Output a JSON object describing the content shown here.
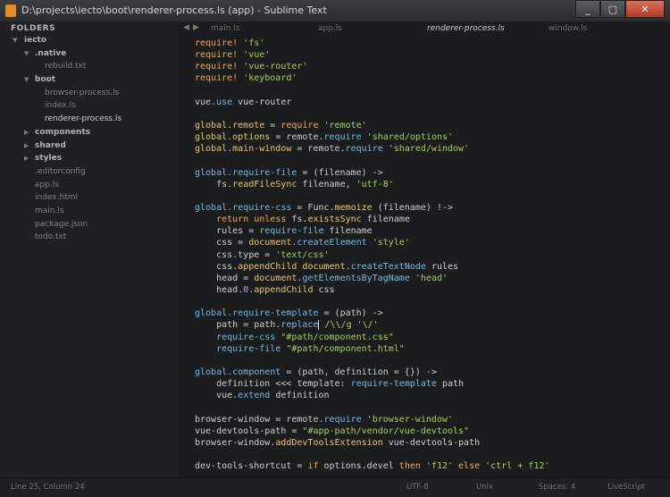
{
  "window": {
    "title": "D:\\projects\\iecto\\boot\\renderer-process.ls (app) - Sublime Text",
    "buttons": [
      "_",
      "▢",
      "✕"
    ]
  },
  "sidebar": {
    "header": "FOLDERS",
    "items": [
      {
        "label": "iecto",
        "type": "folder",
        "depth": 0,
        "arrow": "open"
      },
      {
        "label": ".native",
        "type": "folder",
        "depth": 1,
        "arrow": "open"
      },
      {
        "label": "rebuild.txt",
        "type": "file",
        "depth": 2
      },
      {
        "label": "boot",
        "type": "folder",
        "depth": 1,
        "arrow": "open"
      },
      {
        "label": "browser-process.ls",
        "type": "file",
        "depth": 2
      },
      {
        "label": "index.ls",
        "type": "file",
        "depth": 2
      },
      {
        "label": "renderer-process.ls",
        "type": "file",
        "depth": 2,
        "active": true
      },
      {
        "label": "components",
        "type": "folder",
        "depth": 1,
        "arrow": "closed"
      },
      {
        "label": "shared",
        "type": "folder",
        "depth": 1,
        "arrow": "closed"
      },
      {
        "label": "styles",
        "type": "folder",
        "depth": 1,
        "arrow": "closed"
      },
      {
        "label": ".editorconfig",
        "type": "file",
        "depth": 1
      },
      {
        "label": "app.ls",
        "type": "file",
        "depth": 1
      },
      {
        "label": "index.html",
        "type": "file",
        "depth": 1
      },
      {
        "label": "main.ls",
        "type": "file",
        "depth": 1
      },
      {
        "label": "package.json",
        "type": "file",
        "depth": 1
      },
      {
        "label": "todo.txt",
        "type": "file",
        "depth": 1
      }
    ]
  },
  "tabs": [
    {
      "label": "main.ls",
      "active": false
    },
    {
      "label": "app.ls",
      "active": false
    },
    {
      "label": "renderer-process.ls",
      "active": true
    },
    {
      "label": "window.ls",
      "active": false
    }
  ],
  "code_lines": [
    [
      [
        "require! ",
        "k"
      ],
      [
        "'fs'",
        "s"
      ]
    ],
    [
      [
        "require! ",
        "k"
      ],
      [
        "'vue'",
        "s"
      ]
    ],
    [
      [
        "require! ",
        "k"
      ],
      [
        "'vue-router'",
        "s"
      ]
    ],
    [
      [
        "require! ",
        "k"
      ],
      [
        "'keyboard'",
        "s"
      ]
    ],
    [],
    [
      [
        "vue",
        "p"
      ],
      [
        ".use",
        "f"
      ],
      [
        " vue-router",
        "p"
      ]
    ],
    [],
    [
      [
        "global.remote",
        "v"
      ],
      [
        " = ",
        "p"
      ],
      [
        "require",
        "k"
      ],
      [
        " 'remote'",
        "s"
      ]
    ],
    [
      [
        "global.options",
        "v"
      ],
      [
        " = remote.",
        "p"
      ],
      [
        "require",
        "f"
      ],
      [
        " 'shared/options'",
        "s"
      ]
    ],
    [
      [
        "global.main-window",
        "v"
      ],
      [
        " = remote.",
        "p"
      ],
      [
        "require",
        "f"
      ],
      [
        " 'shared/window'",
        "s"
      ]
    ],
    [],
    [
      [
        "global.require-file",
        "f"
      ],
      [
        " = (filename) ->",
        "p"
      ]
    ],
    [
      [
        "    fs.",
        "p"
      ],
      [
        "readFileSync",
        "v"
      ],
      [
        " filename, ",
        "p"
      ],
      [
        "'utf-8'",
        "s"
      ]
    ],
    [],
    [
      [
        "global.require-css",
        "f"
      ],
      [
        " = Func.",
        "p"
      ],
      [
        "memoize",
        "v"
      ],
      [
        " (filename) !->",
        "p"
      ]
    ],
    [
      [
        "    ",
        "p"
      ],
      [
        "return unless",
        "k"
      ],
      [
        " fs.",
        "p"
      ],
      [
        "existsSync",
        "v"
      ],
      [
        " filename",
        "p"
      ]
    ],
    [
      [
        "    rules = ",
        "p"
      ],
      [
        "require-file",
        "f"
      ],
      [
        " filename",
        "p"
      ]
    ],
    [
      [
        "    css = ",
        "p"
      ],
      [
        "document",
        "v"
      ],
      [
        ".",
        "p"
      ],
      [
        "createElement",
        "f"
      ],
      [
        " 'style'",
        "s"
      ]
    ],
    [
      [
        "    css.type = ",
        "p"
      ],
      [
        "'text/css'",
        "s"
      ]
    ],
    [
      [
        "    css.",
        "p"
      ],
      [
        "appendChild",
        "v"
      ],
      [
        " document",
        "v"
      ],
      [
        ".",
        "p"
      ],
      [
        "createTextNode",
        "f"
      ],
      [
        " rules",
        "p"
      ]
    ],
    [
      [
        "    head = ",
        "p"
      ],
      [
        "document",
        "v"
      ],
      [
        ".",
        "p"
      ],
      [
        "getElementsByTagName",
        "f"
      ],
      [
        " 'head'",
        "s"
      ]
    ],
    [
      [
        "    head.",
        "p"
      ],
      [
        "0",
        "n"
      ],
      [
        ".",
        "p"
      ],
      [
        "appendChild",
        "v"
      ],
      [
        " css",
        "p"
      ]
    ],
    [],
    [
      [
        "global.require-template",
        "f"
      ],
      [
        " = (path) ->",
        "p"
      ]
    ],
    [
      [
        "    path = path.",
        "p"
      ],
      [
        "replace",
        "f"
      ],
      [
        "|",
        "cursor"
      ],
      [
        " /\\\\/g '\\/'",
        "s"
      ]
    ],
    [
      [
        "    require-css",
        "f"
      ],
      [
        " \"#path/component.css\"",
        "s"
      ]
    ],
    [
      [
        "    require-file",
        "f"
      ],
      [
        " \"#path/component.html\"",
        "s"
      ]
    ],
    [],
    [
      [
        "global.component",
        "f"
      ],
      [
        " = (path, definition = {}) ->",
        "p"
      ]
    ],
    [
      [
        "    definition <<< template: ",
        "p"
      ],
      [
        "require-template",
        "f"
      ],
      [
        " path",
        "p"
      ]
    ],
    [
      [
        "    vue.",
        "p"
      ],
      [
        "extend",
        "f"
      ],
      [
        " definition",
        "p"
      ]
    ],
    [],
    [
      [
        "browser-window = remote.",
        "p"
      ],
      [
        "require",
        "f"
      ],
      [
        " 'browser-window'",
        "s"
      ]
    ],
    [
      [
        "vue-devtools-path = ",
        "p"
      ],
      [
        "\"#app-path/vendor/vue-devtools\"",
        "s"
      ]
    ],
    [
      [
        "browser-window.",
        "p"
      ],
      [
        "addDevToolsExtension",
        "v"
      ],
      [
        " vue-devtools-path",
        "p"
      ]
    ],
    [],
    [
      [
        "dev-tools-shortcut = ",
        "p"
      ],
      [
        "if",
        "k"
      ],
      [
        " options.devel ",
        "p"
      ],
      [
        "then",
        "k"
      ],
      [
        " 'f12'",
        "s"
      ],
      [
        " else ",
        "k"
      ],
      [
        "'ctrl + f12'",
        "s"
      ]
    ]
  ],
  "status": {
    "position": "Line 25, Column 24",
    "encoding": "UTF-8",
    "line_endings": "Unix",
    "indent": "Spaces: 4",
    "syntax": "LiveScript"
  }
}
